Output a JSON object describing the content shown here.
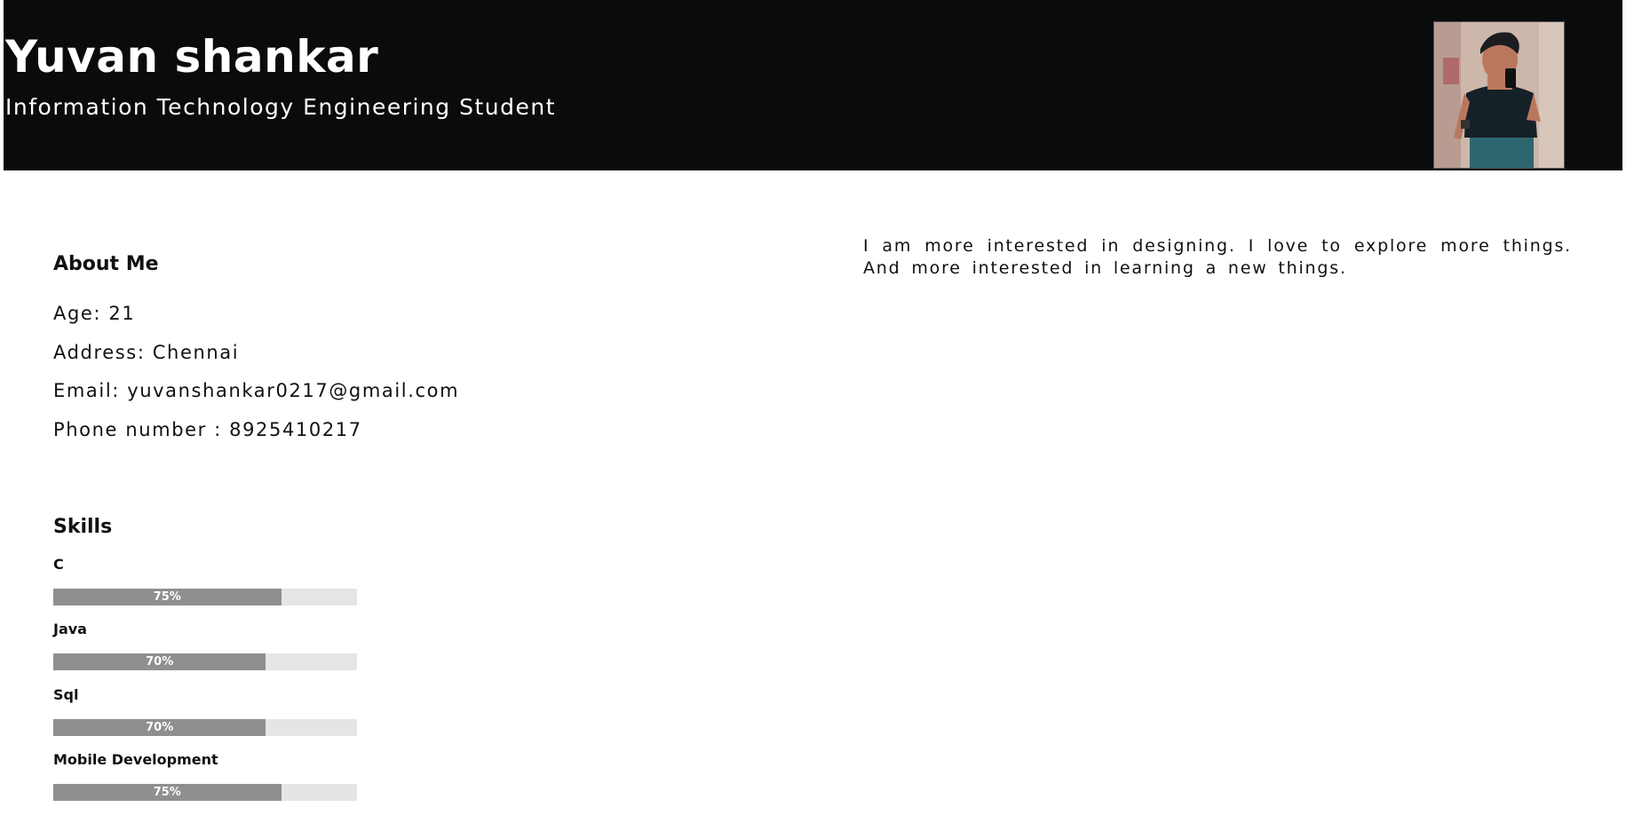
{
  "header": {
    "name": "Yuvan shankar",
    "subtitle": "Information Technology Engineering Student",
    "avatar_icon": "profile-photo",
    "background_color": "#0a0b0d"
  },
  "about": {
    "title": "About Me",
    "age": "Age: 21",
    "address": "Address: Chennai",
    "email": "Email: yuvanshankar0217@gmail.com",
    "phone": "Phone number : 8925410217",
    "bio": "I am more interested in designing. I love to explore more things. And more interested in learning a new things."
  },
  "skills": {
    "title": "Skills",
    "items": [
      {
        "label": "C",
        "percent_text": "75%",
        "level": 75
      },
      {
        "label": "Java",
        "percent_text": "70%",
        "level": 70
      },
      {
        "label": "Sql",
        "percent_text": "70%",
        "level": 70
      },
      {
        "label": "Mobile Development",
        "percent_text": "75%",
        "level": 75
      }
    ],
    "bar_color": "#8e8f91",
    "track_color": "#e5e5e5"
  }
}
